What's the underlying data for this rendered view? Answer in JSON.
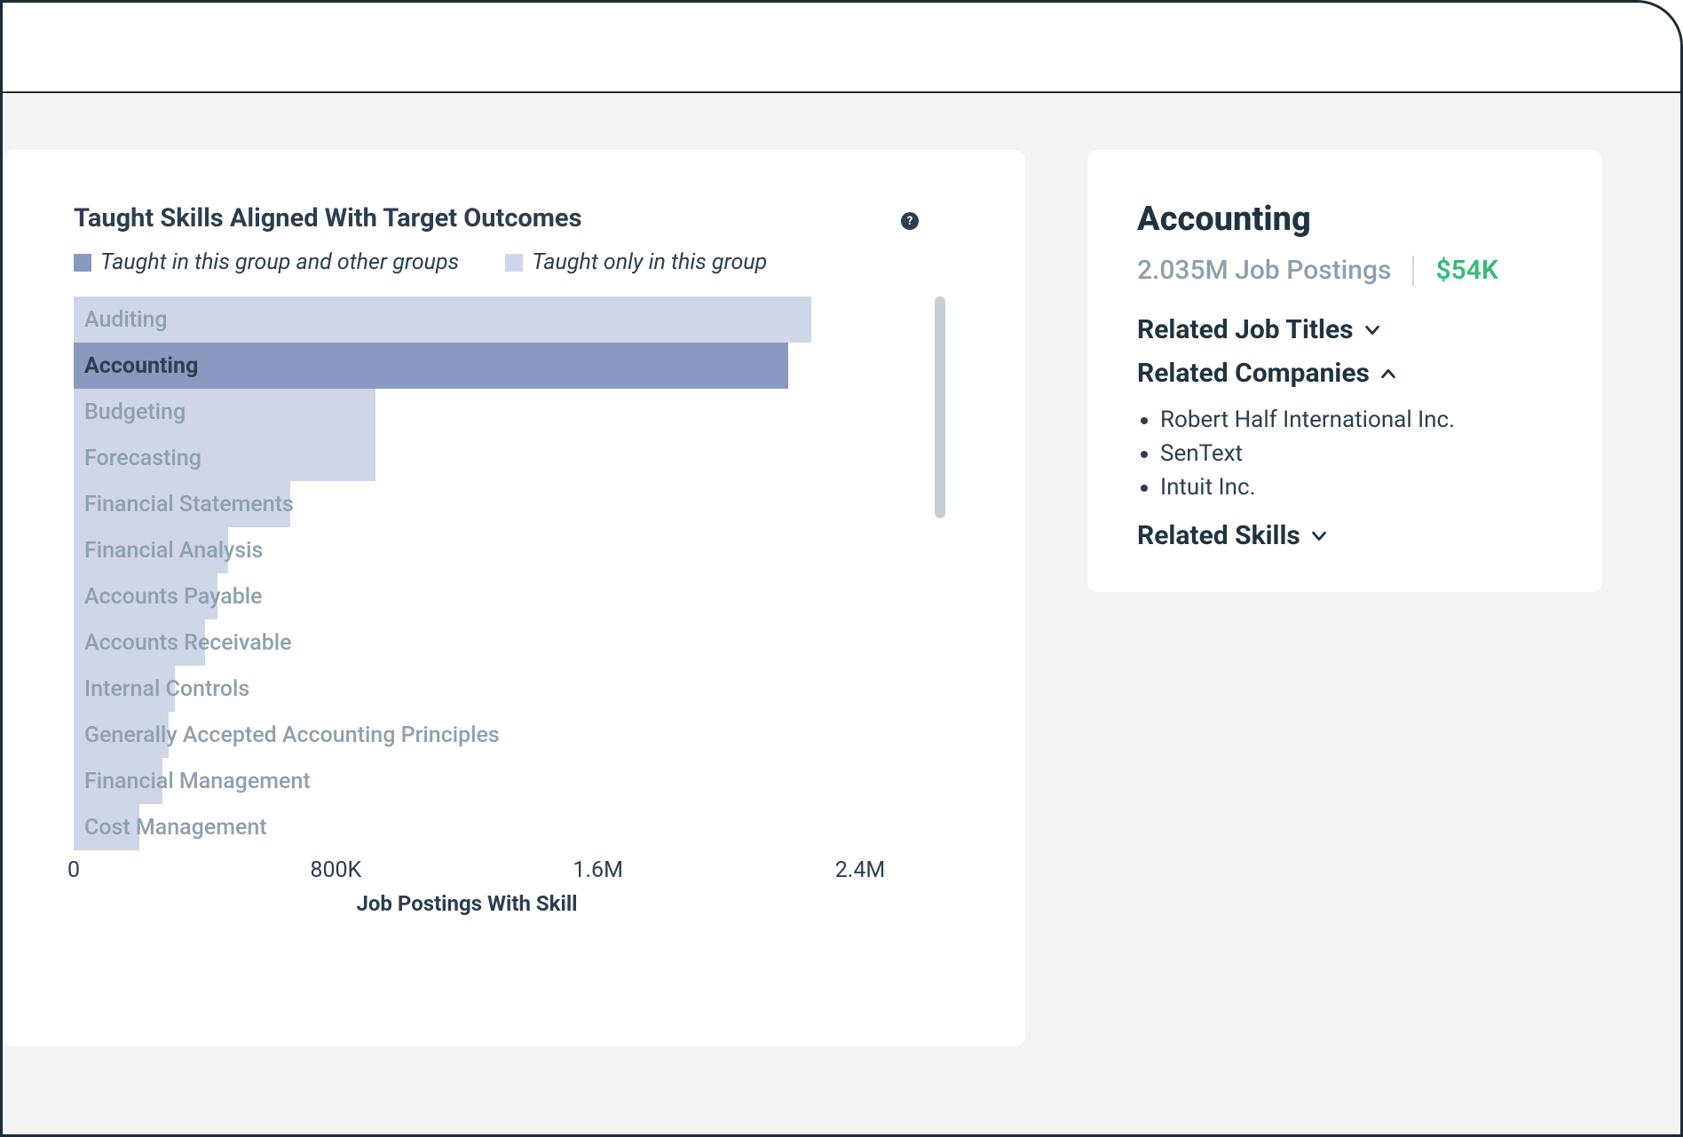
{
  "chart": {
    "title": "Taught Skills Aligned With Target Outcomes",
    "legend": {
      "series_a": "Taught in this group and other groups",
      "series_b": "Taught only in this group"
    },
    "xlabel": "Job Postings With Skill",
    "x_ticks": [
      "0",
      "800K",
      "1.6M",
      "2.4M"
    ]
  },
  "chart_data": {
    "type": "bar",
    "orientation": "horizontal",
    "xlabel": "Job Postings With Skill",
    "xlim": [
      0,
      2400000
    ],
    "x_ticks": [
      0,
      800000,
      1600000,
      2400000
    ],
    "legend": [
      {
        "name": "Taught in this group and other groups",
        "color": "#8b99c0"
      },
      {
        "name": "Taught only in this group",
        "color": "#ced6e8"
      }
    ],
    "selected": "Accounting",
    "categories": [
      "Auditing",
      "Accounting",
      "Budgeting",
      "Forecasting",
      "Financial Statements",
      "Financial Analysis",
      "Accounts Payable",
      "Accounts Receivable",
      "Internal Controls",
      "Generally Accepted Accounting Principles",
      "Financial Management",
      "Cost Management"
    ],
    "values": [
      2250000,
      2180000,
      920000,
      920000,
      660000,
      470000,
      440000,
      400000,
      310000,
      290000,
      270000,
      200000
    ]
  },
  "sidebar": {
    "title": "Accounting",
    "postings_text": "2.035M Job Postings",
    "salary": "$54K",
    "sections": {
      "job_titles": {
        "label": "Related Job Titles",
        "expanded": false
      },
      "companies": {
        "label": "Related Companies",
        "expanded": true,
        "items": [
          "Robert Half International Inc.",
          "SenText",
          "Intuit Inc."
        ]
      },
      "skills": {
        "label": "Related Skills",
        "expanded": false
      }
    }
  }
}
